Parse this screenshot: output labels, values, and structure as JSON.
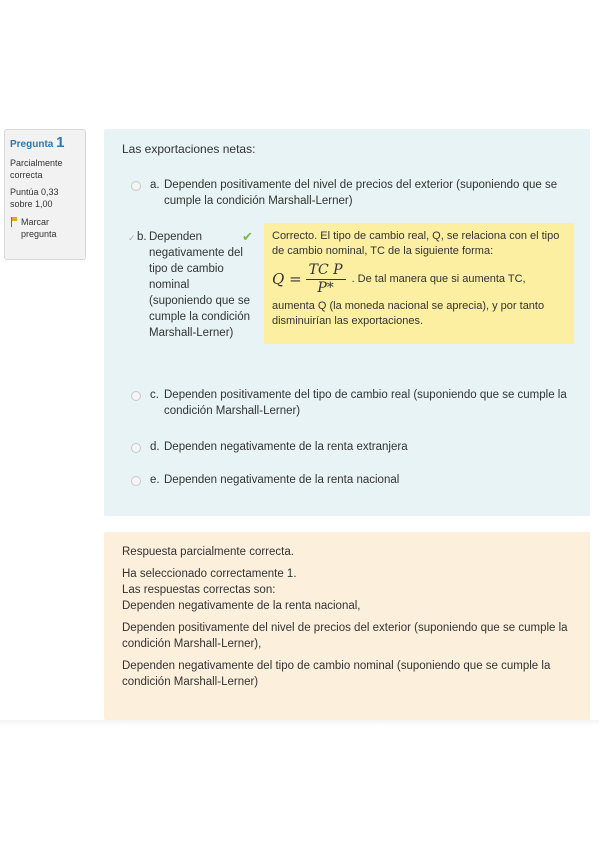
{
  "info": {
    "title_word": "Pregunta",
    "number": "1",
    "state": "Parcialmente correcta",
    "grade": "Puntúa 0,33 sobre 1,00",
    "flag_label": "Marcar pregunta",
    "flag_icon": "flag-icon"
  },
  "question": {
    "text": "Las exportaciones netas:",
    "options": [
      {
        "letter": "a.",
        "text": "Dependen positivamente del nivel de precios del exterior (suponiendo que se cumple la condición Marshall-Lerner)"
      },
      {
        "letter": "b.",
        "text": "Dependen negativamente del tipo de cambio nominal (suponiendo que se cumple la condición Marshall-Lerner)",
        "selected": true,
        "result_icon": "checkmark-icon"
      },
      {
        "letter": "c.",
        "text": "Dependen positivamente del tipo de cambio real (suponiendo que se cumple la condición Marshall-Lerner)"
      },
      {
        "letter": "d.",
        "text": "Dependen negativamente de la renta extranjera"
      },
      {
        "letter": "e.",
        "text": "Dependen negativamente de la renta nacional"
      }
    ],
    "feedback": {
      "line1": "Correcto. El tipo de cambio real, Q, se relaciona con el tipo de cambio nominal, TC de la siguiente forma:",
      "formula_lhs": "Q =",
      "formula_num": "TC P",
      "formula_den": "P*",
      "formula_tail": ". De tal manera que si aumenta TC,",
      "line2": "aumenta Q (la moneda nacional se aprecia), y por tanto disminuirían las exportaciones."
    }
  },
  "outcome": {
    "summary": "Respuesta parcialmente correcta.",
    "selected_count": "Ha seleccionado correctamente 1.",
    "correct_header": "Las respuestas correctas son:",
    "answers": [
      "Dependen negativamente de la renta nacional,",
      "Dependen positivamente del nivel de precios del exterior (suponiendo que se cumple la condición Marshall-Lerner),",
      "Dependen negativamente del tipo de cambio nominal (suponiendo que se cumple la condición Marshall-Lerner)"
    ]
  }
}
